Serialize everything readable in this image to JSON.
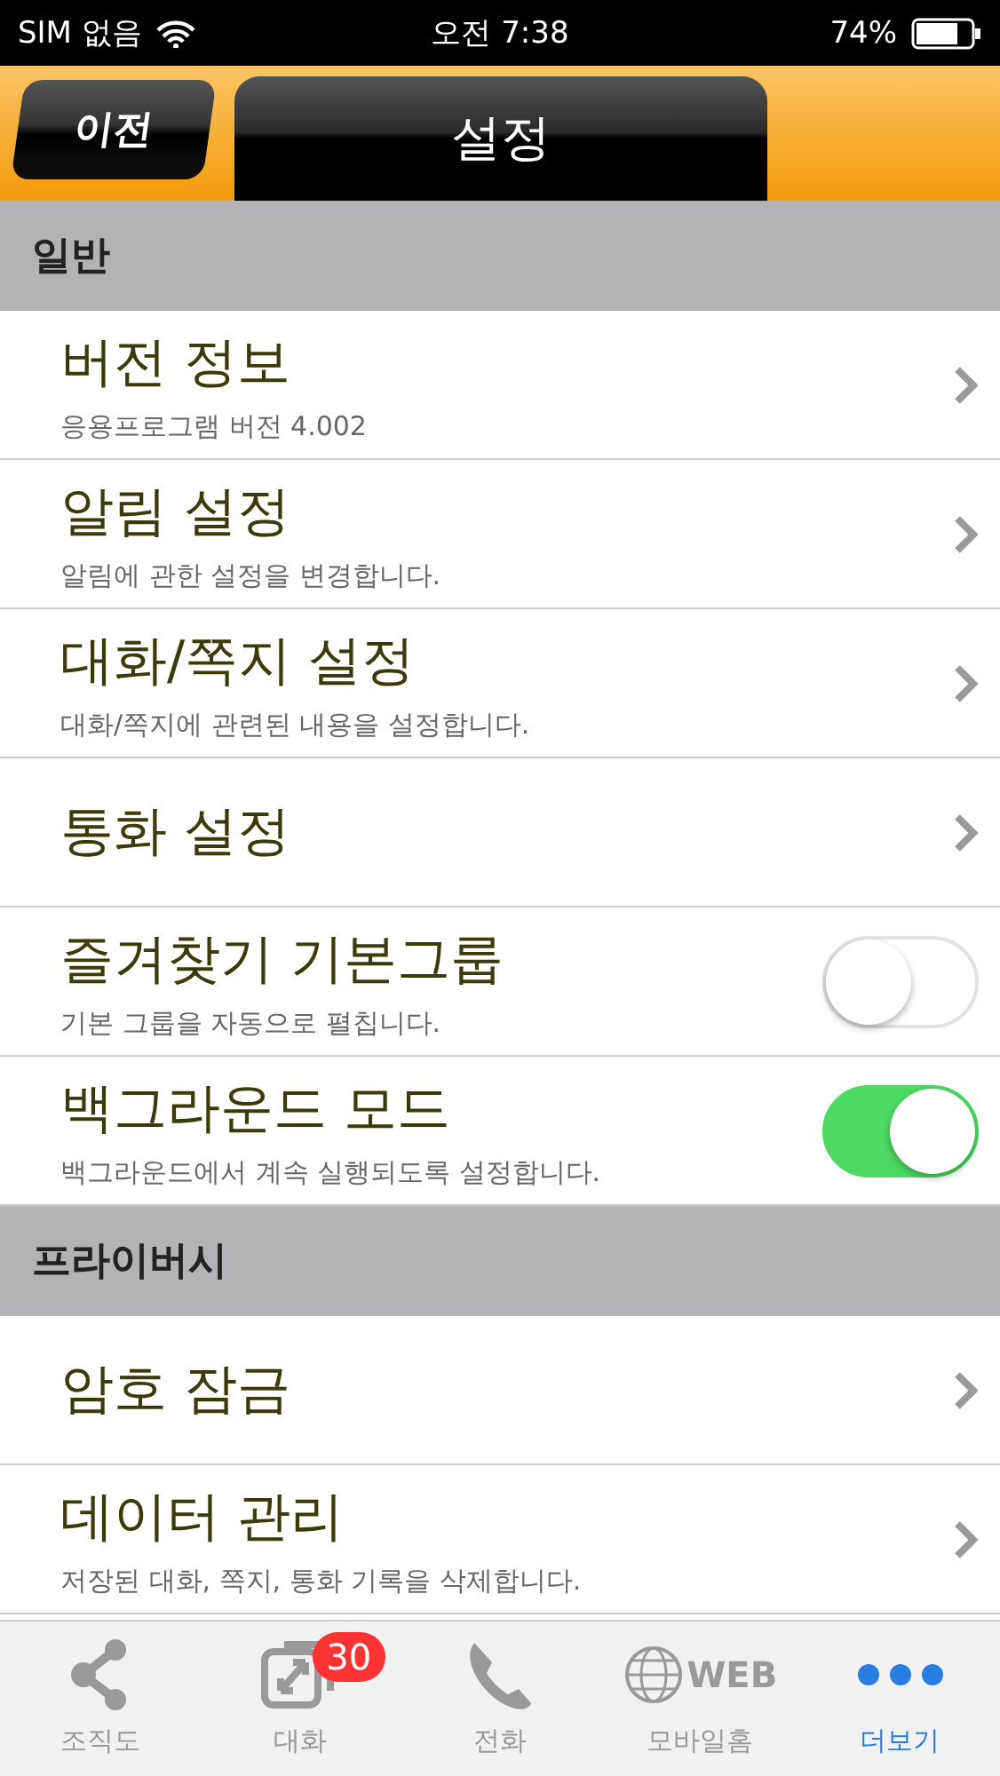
{
  "status_bar": {
    "carrier": "SIM 없음",
    "time": "오전 7:38",
    "battery": "74%"
  },
  "nav": {
    "back": "이전",
    "title": "설정"
  },
  "sections": [
    {
      "title": "일반",
      "rows": [
        {
          "kind": "link",
          "title": "버전 정보",
          "subtitle": "응용프로그램 버전 4.002"
        },
        {
          "kind": "link",
          "title": "알림 설정",
          "subtitle": "알림에 관한 설정을 변경합니다."
        },
        {
          "kind": "link",
          "title": "대화/쪽지 설정",
          "subtitle": "대화/쪽지에 관련된 내용을 설정합니다."
        },
        {
          "kind": "link",
          "title": "통화 설정"
        },
        {
          "kind": "toggle",
          "title": "즐겨찾기 기본그룹",
          "subtitle": "기본 그룹을 자동으로 펼칩니다.",
          "on": false
        },
        {
          "kind": "toggle",
          "title": "백그라운드 모드",
          "subtitle": "백그라운드에서 계속 실행되도록 설정합니다.",
          "on": true
        }
      ]
    },
    {
      "title": "프라이버시",
      "rows": [
        {
          "kind": "link",
          "title": "암호 잠금"
        },
        {
          "kind": "link",
          "title": "데이터 관리",
          "subtitle": "저장된 대화, 쪽지, 통화 기록을 삭제합니다."
        }
      ]
    }
  ],
  "tab_bar": [
    {
      "kind": "org",
      "label": "조직도",
      "selected": false
    },
    {
      "kind": "chat",
      "label": "대화",
      "badge": "30",
      "selected": false
    },
    {
      "kind": "phone",
      "label": "전화",
      "selected": false
    },
    {
      "kind": "web",
      "label": "모바일홈",
      "icon_text": "WEB",
      "selected": false
    },
    {
      "kind": "more",
      "label": "더보기",
      "selected": true
    }
  ]
}
